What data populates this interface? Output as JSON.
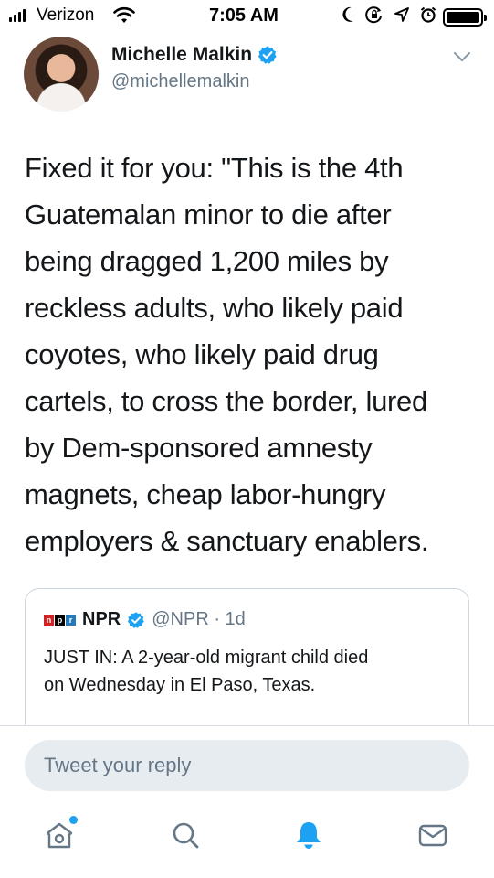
{
  "status_bar": {
    "carrier": "Verizon",
    "time": "7:05 AM",
    "icons": [
      "signal-icon",
      "wifi-icon",
      "moon-icon",
      "rotation-lock-icon",
      "location-icon",
      "alarm-icon",
      "battery-icon"
    ]
  },
  "tweet": {
    "author_name": "Michelle Malkin",
    "author_handle": "@michellemalkin",
    "text": "Fixed it for you: \"This is the 4th\nGuatemalan minor to die after\nbeing dragged 1,200 miles by\nreckless adults, who likely paid\ncoyotes, who likely paid drug\ncartels, to cross the border, lured\nby Dem-sponsored amnesty\nmagnets, cheap labor-hungry\nemployers & sanctuary enablers."
  },
  "quoted_tweet": {
    "logo": [
      "n",
      "p",
      "r"
    ],
    "author_name": "NPR",
    "handle_time": "@NPR · 1d",
    "text": "JUST IN: A 2-year-old migrant child died\non Wednesday in El Paso, Texas."
  },
  "reply": {
    "placeholder": "Tweet your reply"
  },
  "tabs": [
    "home-icon",
    "search-icon",
    "notifications-icon",
    "messages-icon"
  ],
  "colors": {
    "accent": "#1da1f2",
    "text": "#14171a",
    "secondary_text": "#657786",
    "reply_bg": "#e6ecf0",
    "npr_red": "#d62021",
    "npr_black": "#000000",
    "npr_blue": "#237bbd"
  }
}
